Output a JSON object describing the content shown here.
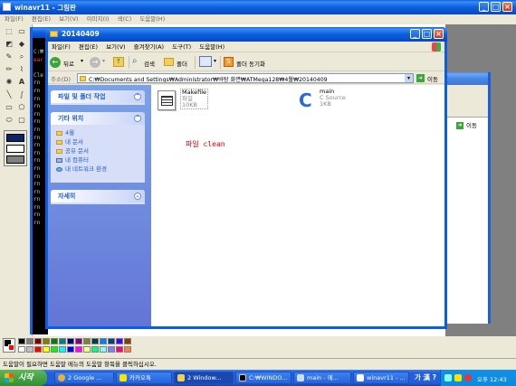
{
  "paint": {
    "title": "winavr11 - 그림판",
    "menu": [
      "파일(F)",
      "편집(E)",
      "보기(V)",
      "이미지(I)",
      "색(C)",
      "도움말(H)"
    ],
    "status": "도움말이 필요하면 도움말 메뉴의 도움말 항목을 클릭하십시오."
  },
  "console": {
    "lines": [
      "C:₩",
      "ear",
      "",
      "Cle",
      "rn",
      "rn",
      "rn",
      "rn",
      "rn",
      "rn",
      "rn",
      "rn",
      "rn",
      "rn",
      "rn",
      "rn",
      "rn",
      "rn",
      "rn",
      "rn",
      "rn",
      "rn",
      "rn"
    ]
  },
  "bgwindow": {
    "go_label": "이동"
  },
  "explorer": {
    "title": "20140409",
    "menu": [
      "파일(F)",
      "편집(E)",
      "보기(V)",
      "즐겨찾기(A)",
      "도구(T)",
      "도움말(H)"
    ],
    "toolbar": {
      "back": "뒤로",
      "search": "검색",
      "folders": "폴더",
      "sync": "폴더 동기화"
    },
    "address_label": "주소(D)",
    "address": "C:₩Documents and Settings₩Administrator₩바탕 화면₩ATMega128₩4월₩20140409",
    "go_label": "이동",
    "panel_tasks": {
      "title": "파일 및 폴더 작업"
    },
    "panel_places": {
      "title": "기타 위치",
      "links": [
        "4월",
        "내 문서",
        "공유 문서",
        "내 컴퓨터",
        "내 네트워크 환경"
      ]
    },
    "panel_details": {
      "title": "자세히"
    },
    "files": [
      {
        "name": "Makefile",
        "type": "파일",
        "size": "10KB"
      },
      {
        "name": "main",
        "type": "C Source",
        "size": "1KB"
      }
    ],
    "annotation": "파일 clean"
  },
  "palette": [
    "#000000",
    "#808080",
    "#800000",
    "#808000",
    "#008000",
    "#008080",
    "#000080",
    "#800080",
    "#808040",
    "#004040",
    "#0080ff",
    "#004080",
    "#4000ff",
    "#804000",
    "#ffffff",
    "#c0c0c0",
    "#ff0000",
    "#ffff00",
    "#00ff00",
    "#00ffff",
    "#0000ff",
    "#ff00ff",
    "#ffff80",
    "#00ff80",
    "#80ffff",
    "#8080ff",
    "#ff0080",
    "#ff8040"
  ],
  "taskbar": {
    "start": "시작",
    "items": [
      "2 Google ...",
      "카카오톡",
      "2 Window...",
      "C:₩WINDO...",
      "main - 메...",
      "winavr11 - ..."
    ],
    "ime": "가 漢 ?",
    "clock": "오후 12:43"
  },
  "colors": {
    "xp_blue": "#0a5ee0",
    "panel": "#d6dff7",
    "annotation": "#e00000"
  }
}
